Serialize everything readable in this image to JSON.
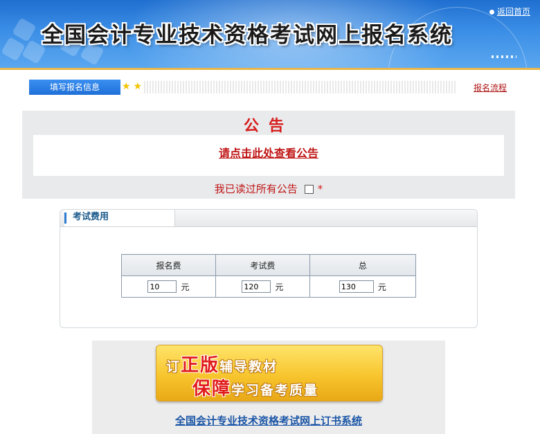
{
  "header": {
    "title": "全国会计专业技术资格考试网上报名系统",
    "home_link": "返回首页"
  },
  "stepbar": {
    "current_step": "填写报名信息",
    "process_link": "报名流程"
  },
  "notice": {
    "title": "公告",
    "link_text": "请点击此处查看公告",
    "confirm_label": "我已读过所有公告",
    "required_mark": "*",
    "confirmed": false
  },
  "fees": {
    "section_title": "考试费用",
    "columns": [
      "报名费",
      "考试费",
      "总"
    ],
    "values": [
      "10",
      "120",
      "130"
    ],
    "unit": "元"
  },
  "ad": {
    "line1_prefix": "订",
    "line1_highlight": "正版",
    "line1_rest": "辅导教材",
    "line2_highlight": "保障",
    "line2_rest": "学习备考质量",
    "link_text": "全国会计专业技术资格考试网上订书系统"
  },
  "colors": {
    "header_blue": "#3b8ee6",
    "accent_red": "#d81e1e",
    "link_blue": "#1a55a6",
    "ad_gold": "#f7c52e"
  }
}
